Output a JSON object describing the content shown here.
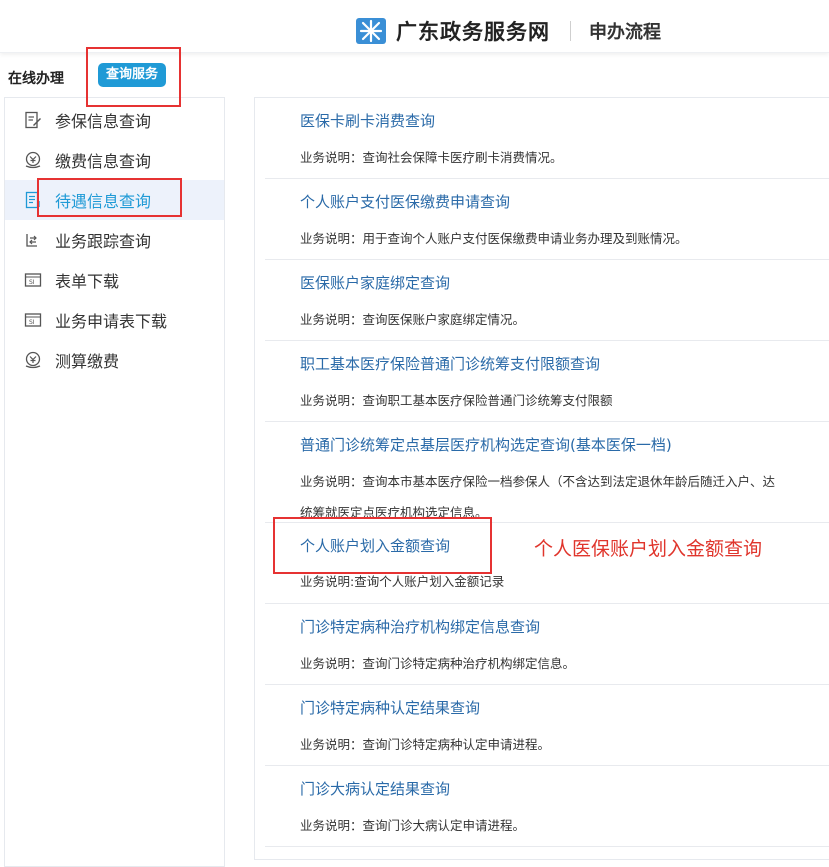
{
  "header": {
    "site_name": "广东政务服务网",
    "subtitle": "申办流程",
    "brand_color": "#3a8fd6"
  },
  "subbar": {
    "title": "在线办理",
    "query_button": "查询服务"
  },
  "sidebar": {
    "items": [
      {
        "label": "参保信息查询",
        "icon": "edit-document-icon"
      },
      {
        "label": "缴费信息查询",
        "icon": "payment-icon"
      },
      {
        "label": "待遇信息查询",
        "icon": "document-list-icon",
        "active": true
      },
      {
        "label": "业务跟踪查询",
        "icon": "tracking-icon"
      },
      {
        "label": "表单下载",
        "icon": "form-download-icon"
      },
      {
        "label": "业务申请表下载",
        "icon": "form-download-icon"
      },
      {
        "label": "测算缴费",
        "icon": "calculator-icon"
      }
    ]
  },
  "services": [
    {
      "title": "医保卡刷卡消费查询",
      "desc": "业务说明：查询社会保障卡医疗刷卡消费情况。"
    },
    {
      "title": "个人账户支付医保缴费申请查询",
      "desc": "业务说明：用于查询个人账户支付医保缴费申请业务办理及到账情况。"
    },
    {
      "title": "医保账户家庭绑定查询",
      "desc": "业务说明：查询医保账户家庭绑定情况。"
    },
    {
      "title": "职工基本医疗保险普通门诊统筹支付限额查询",
      "desc": "业务说明：查询职工基本医疗保险普通门诊统筹支付限额"
    },
    {
      "title": "普通门诊统筹定点基层医疗机构选定查询(基本医保一档)",
      "desc": "业务说明：查询本市基本医疗保险一档参保人（不含达到法定退休年龄后随迁入户、达",
      "desc2": "统筹就医定点医疗机构选定信息。"
    },
    {
      "title": "个人账户划入金额查询",
      "desc": "业务说明:查询个人账户划入金额记录"
    },
    {
      "title": "门诊特定病种治疗机构绑定信息查询",
      "desc": "业务说明：查询门诊特定病种治疗机构绑定信息。"
    },
    {
      "title": "门诊特定病种认定结果查询",
      "desc": "业务说明：查询门诊特定病种认定申请进程。"
    },
    {
      "title": "门诊大病认定结果查询",
      "desc": "业务说明：查询门诊大病认定申请进程。"
    }
  ],
  "annotation": "个人医保账户划入金额查询",
  "colors": {
    "accent": "#1f9ad6",
    "link": "#2a6aa8",
    "highlight_box": "#e63232",
    "annotation": "#e0352c"
  }
}
